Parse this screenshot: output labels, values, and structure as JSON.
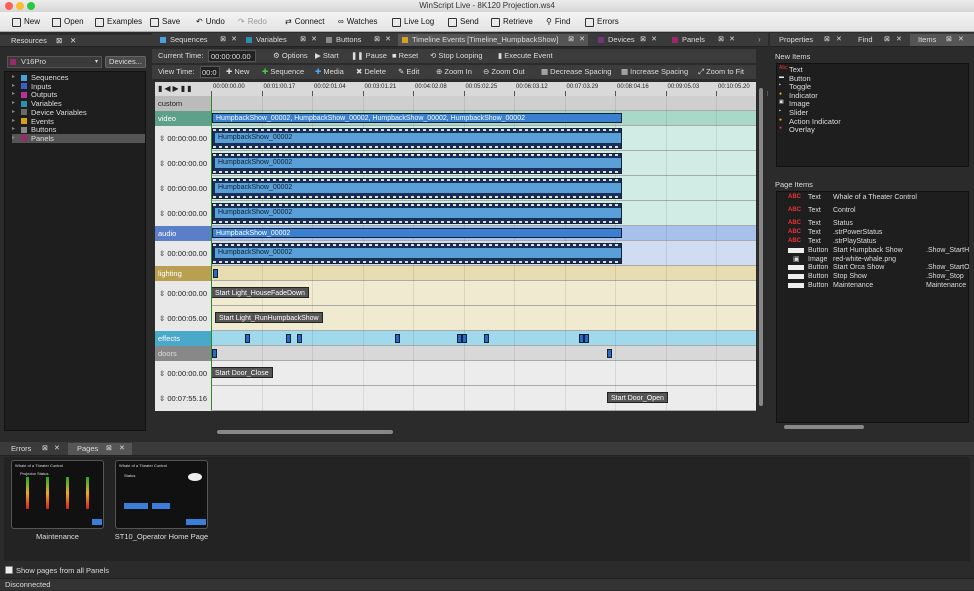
{
  "window": {
    "title": "WinScript Live - 8K120 Projection.ws4"
  },
  "toolbar": {
    "new": "New",
    "open": "Open",
    "examples": "Examples",
    "save": "Save",
    "undo": "Undo",
    "redo": "Redo",
    "connect": "Connect",
    "watches": "Watches",
    "livelog": "Live Log",
    "send": "Send",
    "retrieve": "Retrieve",
    "find": "Find",
    "errors": "Errors"
  },
  "resources": {
    "title": "Resources",
    "device": "V16Pro",
    "devices_button": "Devices...",
    "items": [
      {
        "label": "Sequences",
        "color": "#4aa3d8"
      },
      {
        "label": "Inputs",
        "color": "#3b5fc8"
      },
      {
        "label": "Outputs",
        "color": "#b8329a"
      },
      {
        "label": "Variables",
        "color": "#2a8fb0"
      },
      {
        "label": "Device Variables",
        "color": "#6a6a6a"
      },
      {
        "label": "Events",
        "color": "#d8a020"
      },
      {
        "label": "Buttons",
        "color": "#888888"
      },
      {
        "label": "Panels",
        "color": "#9a2a6a"
      }
    ]
  },
  "tabs": [
    {
      "label": "Sequences",
      "color": "#4aa3d8"
    },
    {
      "label": "Variables",
      "color": "#2a8fb0"
    },
    {
      "label": "Buttons",
      "color": "#888888"
    },
    {
      "label": "Timeline Events [Timeline_HumpbackShow]",
      "color": "#d8a020"
    },
    {
      "label": "Devices",
      "color": "#6a3a7a"
    },
    {
      "label": "Panels",
      "color": "#9a2a6a"
    }
  ],
  "controls": {
    "current_time_label": "Current Time:",
    "current_time_value": "00:00:00.00",
    "options": "Options",
    "start": "Start",
    "pause": "Pause",
    "reset": "Reset",
    "stop_looping": "Stop Looping",
    "execute_event": "Execute Event",
    "view_time_label": "View Time:",
    "view_time_value": "00:0",
    "new": "New",
    "sequence": "Sequence",
    "media": "Media",
    "delete": "Delete",
    "edit": "Edit",
    "zoom_in": "Zoom In",
    "zoom_out": "Zoom Out",
    "decrease_spacing": "Decrease Spacing",
    "increase_spacing": "Increase Spacing",
    "zoom_to_fit": "Zoom to Fit"
  },
  "ruler": [
    "00:00:00.00",
    "00:01:00.17",
    "00:02:01.04",
    "00:03:01.21",
    "00:04:02.08",
    "00:05:02.25",
    "00:06:03.12",
    "00:07:03.29",
    "00:08:04.16",
    "00:09:05.03",
    "00:10:05.20"
  ],
  "timeline": {
    "custom": "custom",
    "video": "video",
    "video_clip": "HumpbackShow_00002, HumpbackShow_00002, HumpbackShow_00002, HumpbackShow_00002",
    "audio": "audio",
    "audio_clip": "HumpbackShow_00002",
    "clip": "HumpbackShow_00002",
    "time0": "00:00:00.00",
    "lighting": "lighting",
    "light_time1": "00:00:00.00",
    "light_event1": "Start Light_HouseFadeDown",
    "light_time2": "00:00:05.00",
    "light_event2": "Start Light_RunHumpbackShow",
    "effects": "effects",
    "doors": "doors",
    "door_time1": "00:00:00.00",
    "door_event1": "Start Door_Close",
    "door_time2": "00:07:55.16",
    "door_event2": "Start Door_Open"
  },
  "right_tabs": {
    "properties": "Properties",
    "find": "Find",
    "items": "Items"
  },
  "new_items": {
    "title": "New Items",
    "list": [
      "Text",
      "Button",
      "Toggle",
      "Indicator",
      "Image",
      "Slider",
      "Action Indicator",
      "Overlay"
    ]
  },
  "page_items": {
    "title": "Page Items",
    "rows": [
      {
        "icon": "ABC",
        "type": "Text",
        "name": "Whale of a Theater Control",
        "action": ""
      },
      {
        "icon": "ABC",
        "type": "Text",
        "name": "Control",
        "action": ""
      },
      {
        "icon": "ABC",
        "type": "Text",
        "name": "Status",
        "action": ""
      },
      {
        "icon": "ABC",
        "type": "Text",
        "name": ".strPowerStatus",
        "action": ""
      },
      {
        "icon": "ABC",
        "type": "Text",
        "name": ".strPlayStatus",
        "action": ""
      },
      {
        "icon": "btn",
        "type": "Button",
        "name": "Start Humpback Show",
        "action": ".Show_StartH"
      },
      {
        "icon": "img",
        "type": "Image",
        "name": "red-white-whale.png",
        "action": ""
      },
      {
        "icon": "btn",
        "type": "Button",
        "name": "Start Orca Show",
        "action": ".Show_StartO"
      },
      {
        "icon": "btn",
        "type": "Button",
        "name": "Stop Show",
        "action": ".Show_Stop"
      },
      {
        "icon": "btn",
        "type": "Button",
        "name": "Maintenance",
        "action": "Maintenance"
      }
    ]
  },
  "bottom": {
    "errors_tab": "Errors",
    "pages_tab": "Pages",
    "page1_title": "Whale of a Theater Control",
    "page1_sub": "Projector Status",
    "page1_label": "Maintenance",
    "page2_title": "Whale of a Theater Control",
    "page2_sub": "Status",
    "page2_label": "ST10_Operator Home Page",
    "show_pages": "Show pages from all Panels",
    "status": "Disconnected"
  }
}
